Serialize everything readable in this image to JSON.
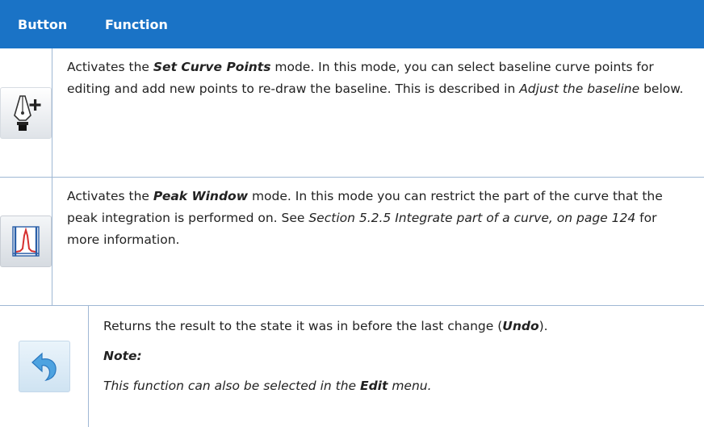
{
  "header": {
    "col_button": "Button",
    "col_function": "Function"
  },
  "rows": [
    {
      "icon": "set-curve-points-icon",
      "seg": [
        "Activates the ",
        "Set Curve Points",
        " mode. In this mode, you can select baseline curve points for editing and add new points to re-draw the baseline. This is described in ",
        "Adjust the baseline",
        " below."
      ]
    },
    {
      "icon": "peak-window-icon",
      "seg": [
        "Activates the ",
        "Peak Window",
        " mode. In this mode you can restrict the part of the curve that the peak integration is performed on. See ",
        "Section 5.2.5 Integrate part of a curve, on page 124",
        " for more information."
      ]
    },
    {
      "icon": "undo-icon",
      "seg": [
        "Returns the result to the state it was in before the last change (",
        "Undo",
        ")."
      ],
      "note_label": "Note:",
      "note_seg": [
        "This function can also be selected in the ",
        "Edit",
        " menu."
      ]
    }
  ],
  "colors": {
    "header_bg": "#1a73c6",
    "border": "#9fb8d4"
  }
}
